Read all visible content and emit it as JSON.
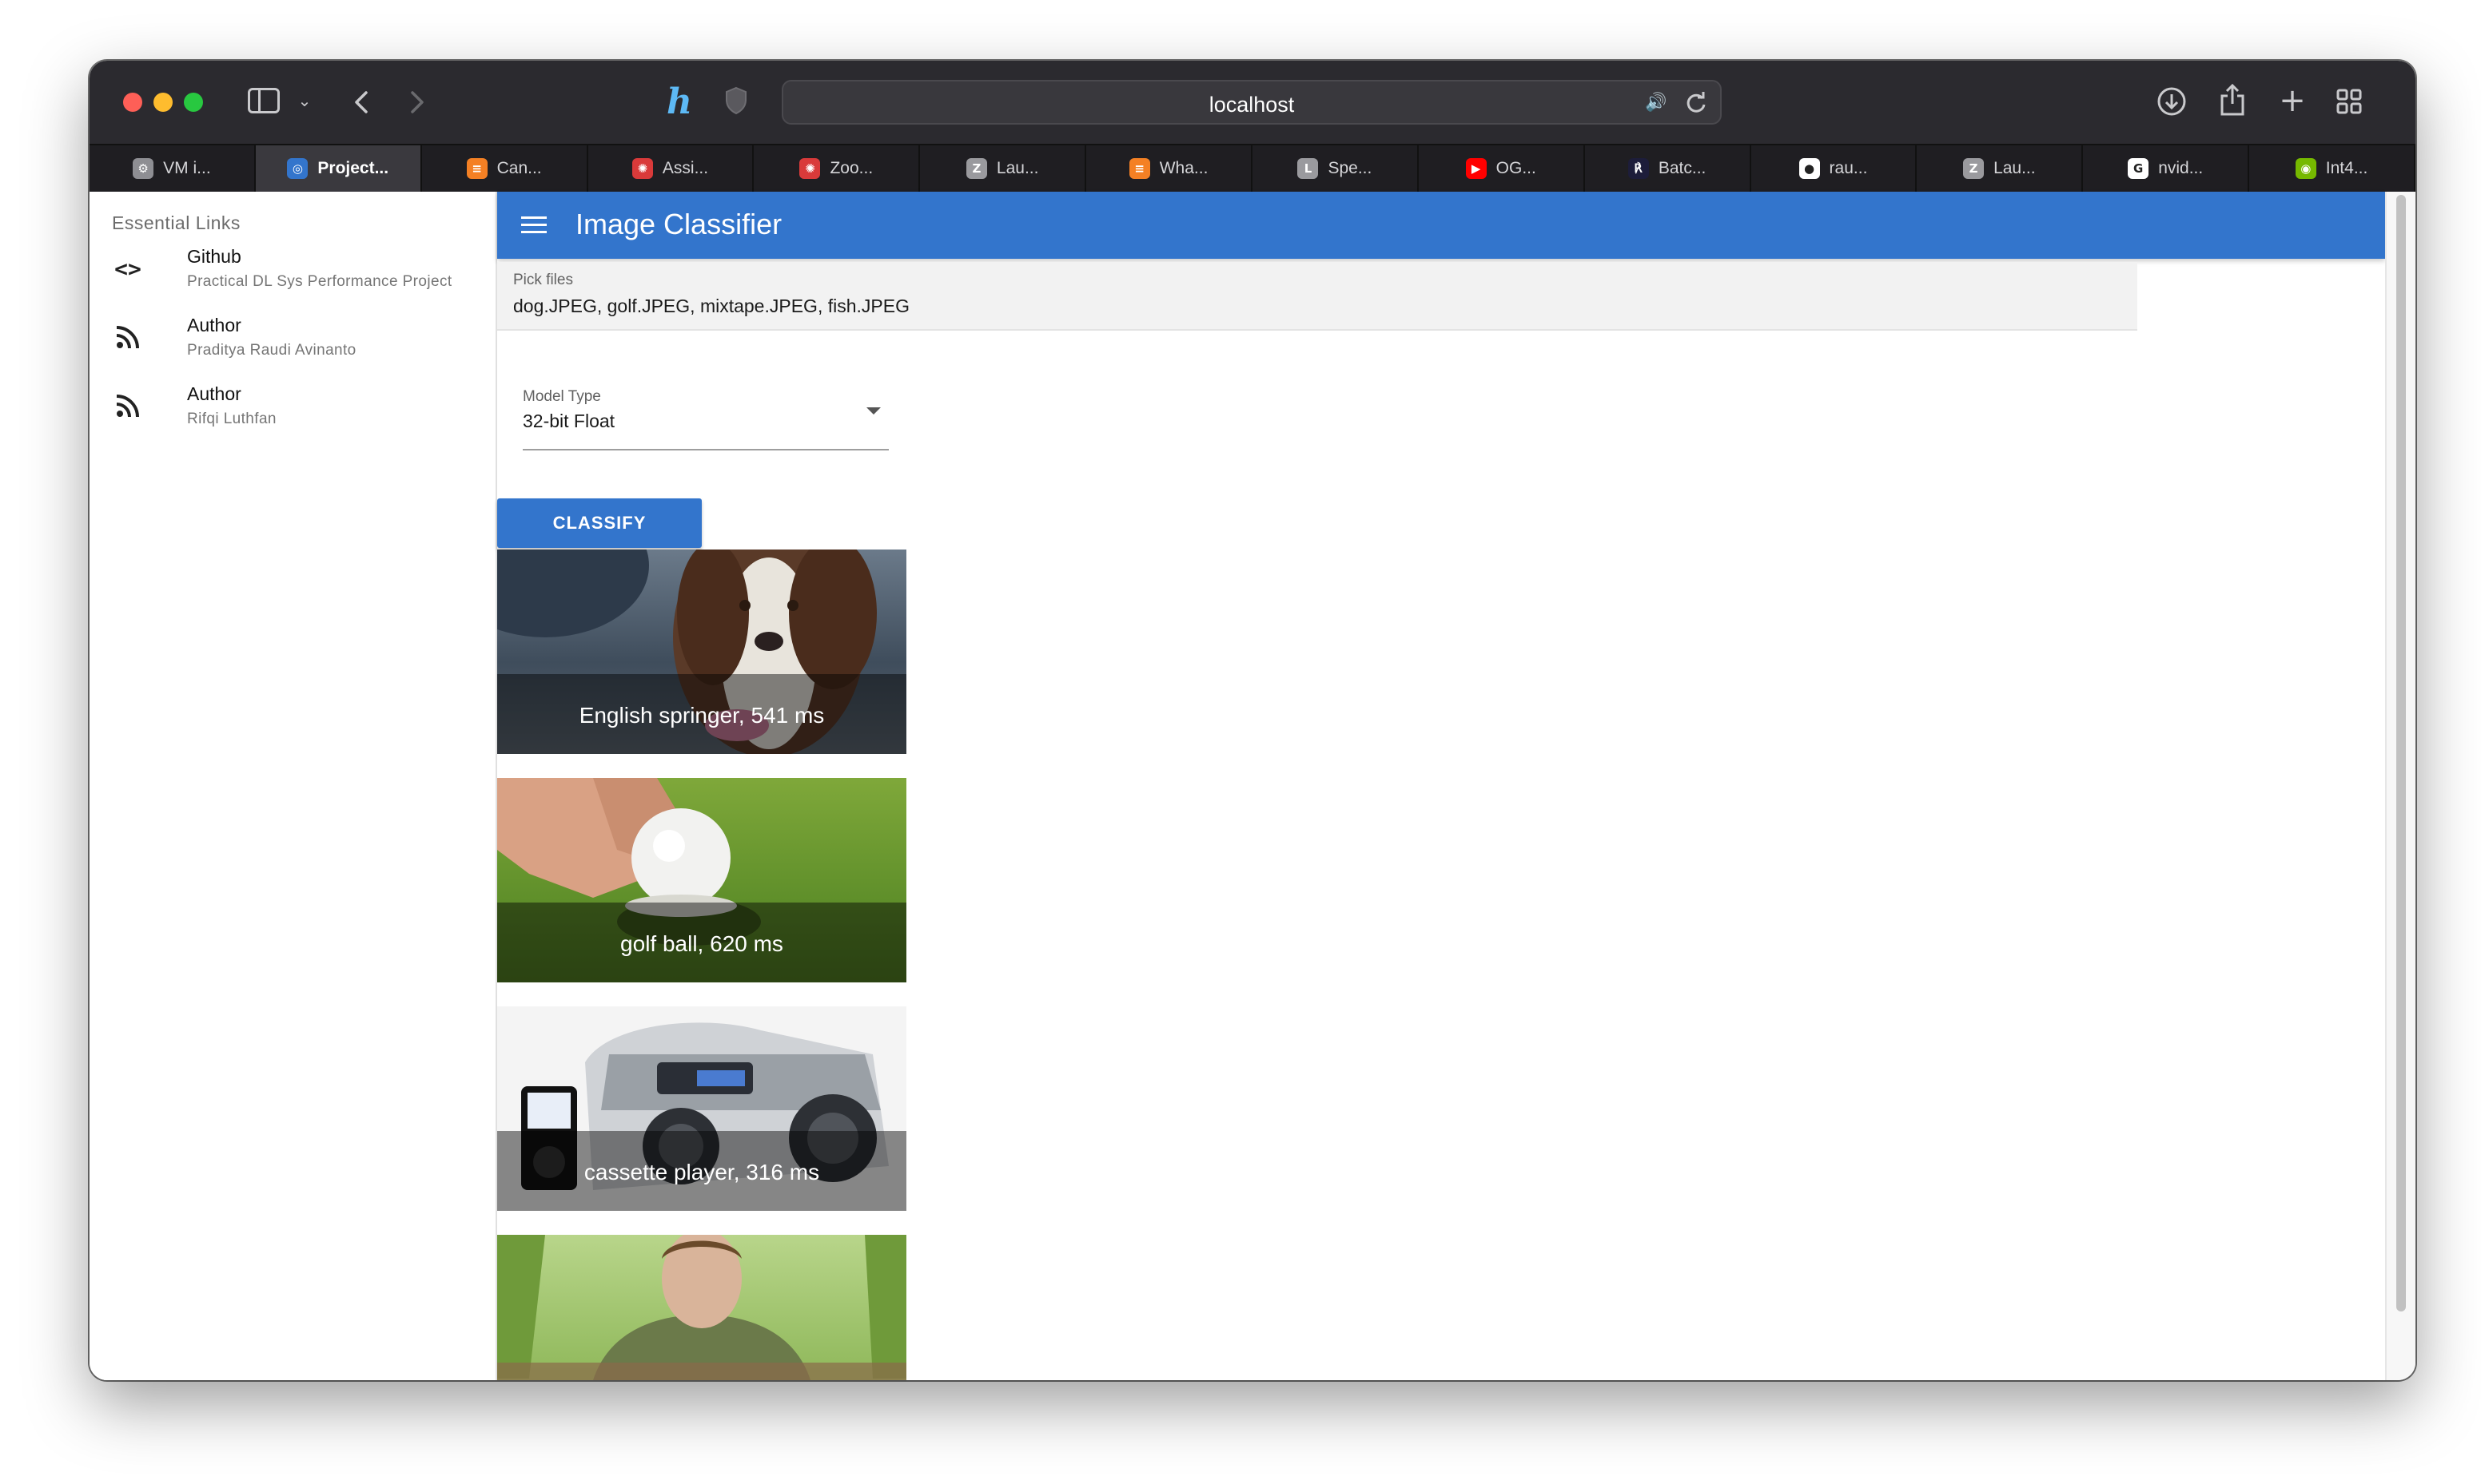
{
  "browser": {
    "url": "localhost",
    "tabs": [
      {
        "label": "VM i...",
        "favicon": "gear-icon",
        "color": "#8e8e93",
        "glyph": "⚙"
      },
      {
        "label": "Project...",
        "favicon": "app-icon",
        "color": "#3375cc",
        "glyph": "◎"
      },
      {
        "label": "Can...",
        "favicon": "stackoverflow-icon",
        "color": "#f48024",
        "glyph": "≡"
      },
      {
        "label": "Assi...",
        "favicon": "course-icon",
        "color": "#d93a3a",
        "glyph": "✺"
      },
      {
        "label": "Zoo...",
        "favicon": "course-icon",
        "color": "#d93a3a",
        "glyph": "✺"
      },
      {
        "label": "Lau...",
        "favicon": "z-icon",
        "color": "#9a9a9e",
        "glyph": "Z"
      },
      {
        "label": "Wha...",
        "favicon": "stackoverflow-icon",
        "color": "#f48024",
        "glyph": "≡"
      },
      {
        "label": "Spe...",
        "favicon": "l-icon",
        "color": "#9a9a9e",
        "glyph": "L"
      },
      {
        "label": "OG...",
        "favicon": "youtube-icon",
        "color": "#ff0000",
        "glyph": "▶"
      },
      {
        "label": "Batc...",
        "favicon": "docs-icon",
        "color": "#1d1d3a",
        "glyph": "℟"
      },
      {
        "label": "rau...",
        "favicon": "github-icon",
        "color": "#ffffff",
        "glyph": "●"
      },
      {
        "label": "Lau...",
        "favicon": "z-icon",
        "color": "#9a9a9e",
        "glyph": "Z"
      },
      {
        "label": "nvid...",
        "favicon": "google-icon",
        "color": "#ffffff",
        "glyph": "G"
      },
      {
        "label": "Int4...",
        "favicon": "nvidia-icon",
        "color": "#76b900",
        "glyph": "◉"
      }
    ]
  },
  "drawer": {
    "header": "Essential Links",
    "links": [
      {
        "title": "Github",
        "caption": "Practical DL Sys Performance Project",
        "icon": "code-icon"
      },
      {
        "title": "Author",
        "caption": "Praditya Raudi Avinanto",
        "icon": "rss-feed-icon"
      },
      {
        "title": "Author",
        "caption": "Rifqi Luthfan",
        "icon": "rss-feed-icon"
      }
    ]
  },
  "appbar": {
    "title": "Image Classifier"
  },
  "files": {
    "label": "Pick files",
    "value": "dog.JPEG, golf.JPEG, mixtape.JPEG, fish.JPEG"
  },
  "model": {
    "label": "Model Type",
    "value": "32-bit Float"
  },
  "classify_label": "CLASSIFY",
  "results": [
    {
      "caption": "English springer, 541 ms"
    },
    {
      "caption": "golf ball, 620 ms"
    },
    {
      "caption": "cassette player, 316 ms"
    },
    {
      "caption": ""
    }
  ],
  "colors": {
    "primary": "#3375cc",
    "titlebar": "#2b2a2f"
  }
}
